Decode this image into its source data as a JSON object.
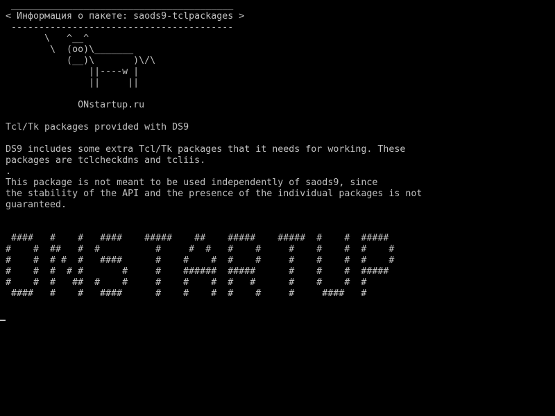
{
  "terminal": {
    "cowsay": {
      "border_top": " ________________________________________",
      "message": "< Информация о пакете: saods9-tclpackages >",
      "border_bottom": " ----------------------------------------",
      "cow_line1": "       \\   ^__^",
      "cow_line2": "        \\  (oo)\\_______",
      "cow_line3": "           (__)\\       )\\/\\",
      "cow_line4": "               ||----w |",
      "cow_line5": "               ||     ||"
    },
    "site": "             ONstartup.ru",
    "description": {
      "summary": "Tcl/Tk packages provided with DS9",
      "para1_line1": "DS9 includes some extra Tcl/Tk packages that it needs for working. These",
      "para1_line2": "packages are tclcheckdns and tcliis.",
      "separator": ".",
      "para2_line1": "This package is not meant to be used independently of saods9, since",
      "para2_line2": "the stability of the API and the presence of the individual packages is not",
      "para2_line3": "guaranteed."
    },
    "banner": {
      "line1": " ####   #    #   ####    #####    ##    #####    #####  #    #  #####",
      "line2": "#    #  ##   #  #          #     #  #   #    #     #    #    #  #    #",
      "line3": "#    #  # #  #   ####      #    #    #  #    #     #    #    #  #    #",
      "line4": "#    #  #  # #       #     #    ######  #####      #    #    #  #####",
      "line5": "#    #  #   ##  #    #     #    #    #  #   #      #    #    #  #",
      "line6": " ####   #    #   ####      #    #    #  #    #     #     ####   #"
    }
  }
}
